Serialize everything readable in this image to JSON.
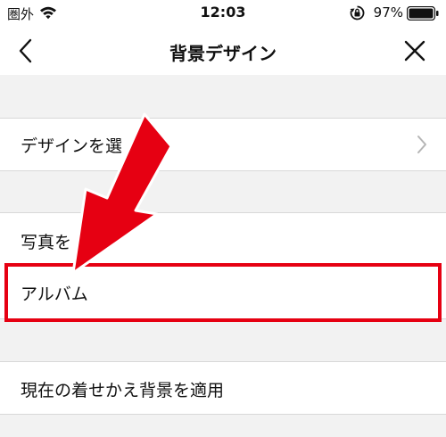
{
  "status_bar": {
    "carrier": "圏外",
    "time": "12:03",
    "battery": "97%",
    "icons": [
      "wifi-icon",
      "rotation-lock-icon",
      "battery-icon"
    ]
  },
  "nav": {
    "title": "背景デザイン",
    "back_icon": "chevron-left-icon",
    "close_icon": "close-icon"
  },
  "menu": {
    "select_design": "デザインを選",
    "photo_header": "写真を",
    "album": "アルバム",
    "apply_current": "現在の着せかえ背景を適用"
  },
  "annotation": {
    "highlight_color": "#e60012",
    "arrow_color": "#e60012"
  }
}
